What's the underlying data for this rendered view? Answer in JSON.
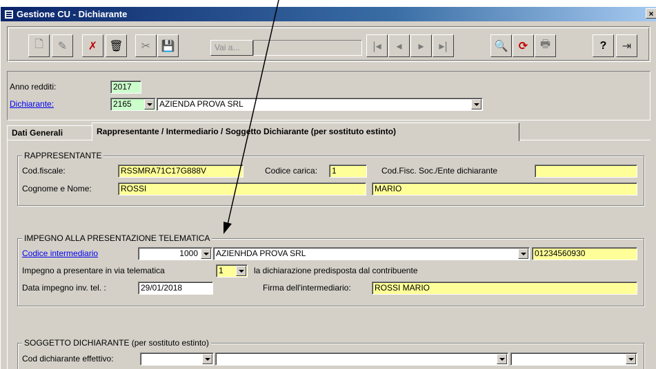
{
  "window": {
    "title": "Gestione CU - Dichiarante",
    "close": "×"
  },
  "toolbar": {
    "vai_label": "Vai a...",
    "vai_value": "",
    "icons": {
      "new": "🗋",
      "edit": "✎",
      "cancel": "✗",
      "delete": "🗑",
      "tool": "✂",
      "save": "💾",
      "first": "|◂",
      "prev": "◂",
      "next": "▸",
      "last": "▸|",
      "preview": "🔍",
      "refresh": "⟳",
      "print": "🖶",
      "help": "?",
      "exit": "⇥"
    }
  },
  "header": {
    "anno_label": "Anno redditi:",
    "anno_value": "2017",
    "dichiarante_label": "Dichiarante:",
    "dichiarante_code": "2165",
    "dichiarante_name": "AZIENDA PROVA SRL"
  },
  "tabs": [
    {
      "label": "Dati Generali"
    },
    {
      "label": "Rappresentante / Intermediario / Soggetto Dichiarante (per sostituto estinto)"
    }
  ],
  "rappresentante": {
    "legend": "RAPPRESENTANTE",
    "codfiscale_label": "Cod.fiscale:",
    "codfiscale_value": "RSSMRA71C17G888V",
    "carica_label": "Codice carica:",
    "carica_value": "1",
    "codfisc_soc_label": "Cod.Fisc. Soc./Ente dichiarante",
    "codfisc_soc_value": "",
    "nome_label": "Cognome e Nome:",
    "cognome_value": "ROSSI",
    "nome_value": "MARIO"
  },
  "impegno": {
    "legend": "IMPEGNO ALLA PRESENTAZIONE TELEMATICA",
    "intermediario_label": "Codice intermediario",
    "intermediario_code": "1000",
    "intermediario_name": "AZIENHDA PROVA SRL",
    "intermediario_cf": "01234560930",
    "impegno_label": "Impegno a presentare in via telematica",
    "impegno_value": "1",
    "impegno_desc": "la dichiarazione predisposta dal contribuente",
    "data_label": "Data impegno inv. tel. :",
    "data_value": "29/01/2018",
    "firma_label": "Firma dell'intermediario:",
    "firma_value": "ROSSI MARIO"
  },
  "soggetto": {
    "legend": "SOGGETTO DICHIARANTE",
    "legend_suffix": " (per sostituto estinto)",
    "cod_label": "Cod dichiarante effettivo:",
    "cod_value": "",
    "name_value": "",
    "extra_value": ""
  }
}
